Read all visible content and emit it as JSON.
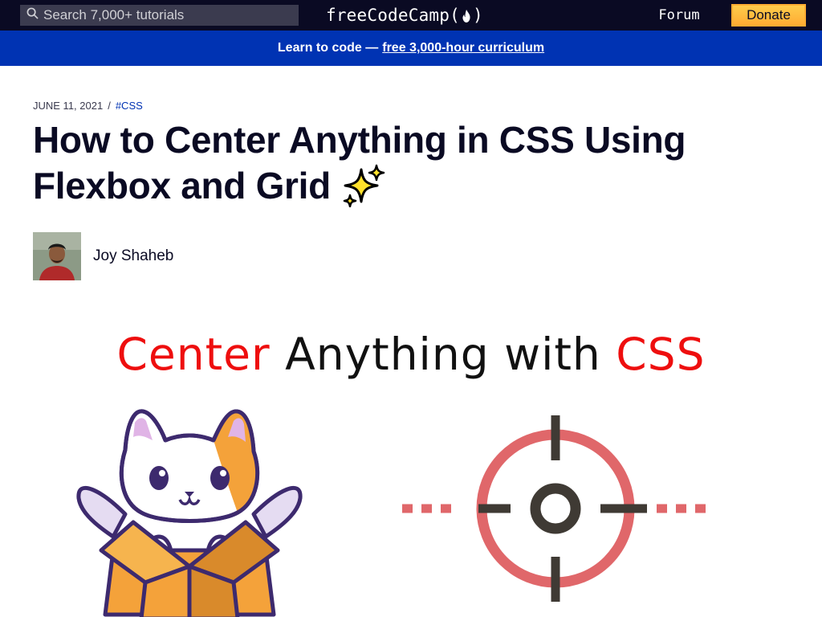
{
  "nav": {
    "search_placeholder": "Search 7,000+ tutorials",
    "logo_text_left": "freeCodeCamp(",
    "logo_text_right": ")",
    "forum_label": "Forum",
    "donate_label": "Donate"
  },
  "banner": {
    "prefix": "Learn to code —",
    "link_text": "free 3,000-hour curriculum"
  },
  "article": {
    "date": "JUNE 11, 2021",
    "separator": "/",
    "tag": "#CSS",
    "title": "How to Center Anything in CSS Using Flexbox and Grid",
    "author": "Joy Shaheb"
  },
  "feature_image": {
    "title_part1": "Center",
    "title_part2": "Anything with",
    "title_part3": "CSS"
  },
  "icons": [
    "search-icon",
    "flame-icon",
    "sparkles-icon",
    "cat-in-box-illustration",
    "crosshair-illustration"
  ],
  "colors": {
    "navbar": "#0a0a23",
    "banner": "#0033b3",
    "donate": "#feac32",
    "feature_red": "#ee0e0e",
    "crosshair_red": "#e0676a"
  }
}
